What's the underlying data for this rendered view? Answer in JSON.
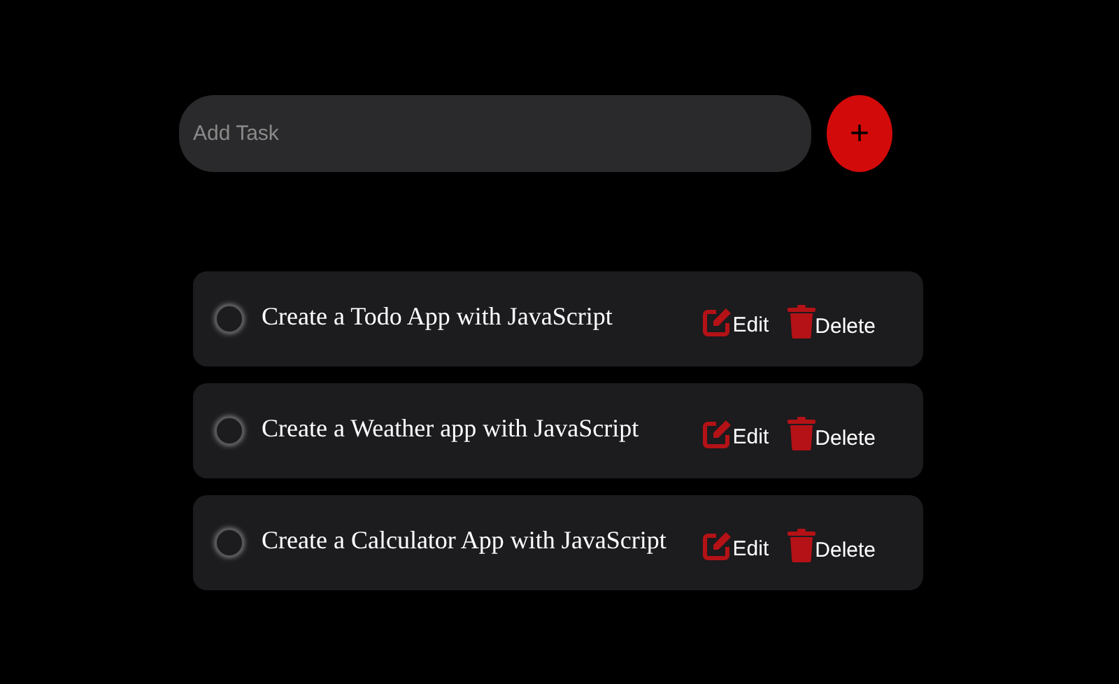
{
  "add_task": {
    "placeholder": "Add Task",
    "button": "+"
  },
  "tasks": [
    {
      "text": "Create a Todo App with JavaScript",
      "checked": false,
      "edit": "Edit",
      "delete": "Delete"
    },
    {
      "text": "Create a Weather app with JavaScript",
      "checked": false,
      "edit": "Edit",
      "delete": "Delete"
    },
    {
      "text": "Create a Calculator App with JavaScript",
      "checked": false,
      "edit": "Edit",
      "delete": "Delete"
    }
  ]
}
